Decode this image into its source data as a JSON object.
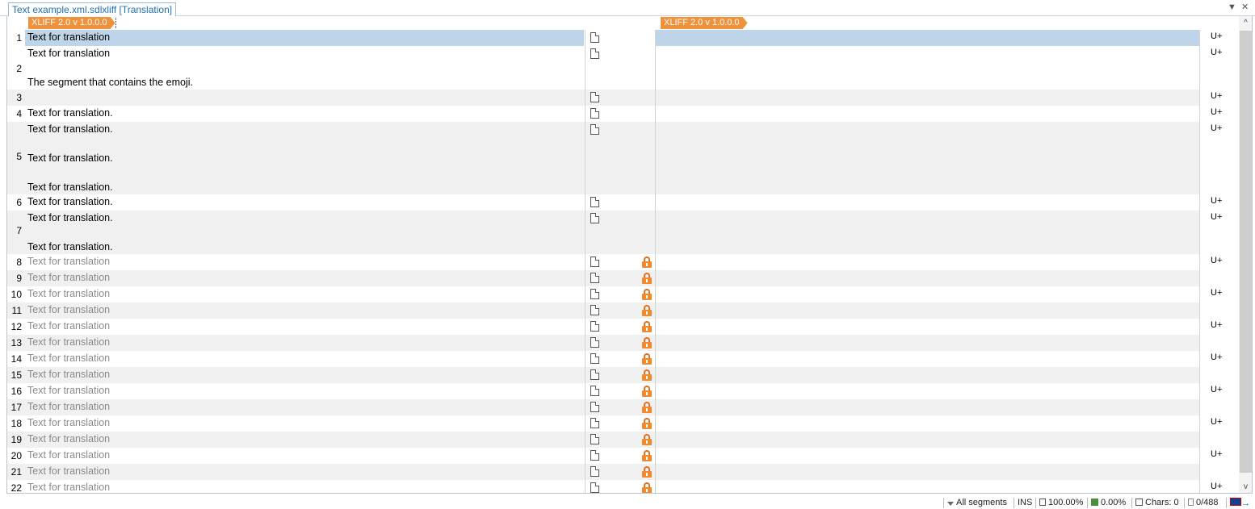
{
  "tab": {
    "title": "Text example.xml.sdlxliff [Translation]"
  },
  "window_controls": {
    "menu_glyph": "▼",
    "close_glyph": "✕"
  },
  "header": {
    "source_tag": "XLIFF 2.0 v 1.0.0.0",
    "target_tag": "XLIFF 2.0 v 1.0.0.0"
  },
  "colors": {
    "tag_orange": "#f0913c",
    "selected_row": "#bed4e8",
    "alt_row": "#f0f0f0",
    "locked_text": "#8a8a8a",
    "lock_icon": "#f08a2c"
  },
  "segments": [
    {
      "num": "1",
      "lines": [
        "Text for translation"
      ],
      "status": "U+",
      "locked": false
    },
    {
      "num": "",
      "lines": [
        "Text for translation"
      ],
      "status": "U+",
      "locked": false
    },
    {
      "num": "2",
      "lines": [
        ""
      ],
      "status": "",
      "locked": false
    },
    {
      "num": "",
      "lines": [
        "The segment that contains the emoji."
      ],
      "status": "",
      "locked": false
    },
    {
      "num": "3",
      "lines": [
        ""
      ],
      "status": "U+",
      "locked": false
    },
    {
      "num": "4",
      "lines": [
        "Text for translation."
      ],
      "status": "U+",
      "locked": false
    },
    {
      "num": "5",
      "lines": [
        "Text for translation.",
        "",
        "Text for translation.",
        "",
        "Text for translation."
      ],
      "status": "U+",
      "locked": false
    },
    {
      "num": "6",
      "lines": [
        "Text for translation."
      ],
      "status": "U+",
      "locked": false
    },
    {
      "num": "7",
      "lines": [
        "Text for translation.",
        "",
        "Text for translation."
      ],
      "status": "U+",
      "locked": false
    },
    {
      "num": "8",
      "lines": [
        "Text for translation"
      ],
      "status": "U+",
      "locked": true
    },
    {
      "num": "9",
      "lines": [
        "Text for translation"
      ],
      "status": "",
      "locked": true
    },
    {
      "num": "10",
      "lines": [
        "Text for translation"
      ],
      "status": "U+",
      "locked": true
    },
    {
      "num": "11",
      "lines": [
        "Text for translation"
      ],
      "status": "",
      "locked": true
    },
    {
      "num": "12",
      "lines": [
        "Text for translation"
      ],
      "status": "U+",
      "locked": true
    },
    {
      "num": "13",
      "lines": [
        "Text for translation"
      ],
      "status": "",
      "locked": true
    },
    {
      "num": "14",
      "lines": [
        "Text for translation"
      ],
      "status": "U+",
      "locked": true
    },
    {
      "num": "15",
      "lines": [
        "Text for translation"
      ],
      "status": "",
      "locked": true
    },
    {
      "num": "16",
      "lines": [
        "Text for translation"
      ],
      "status": "U+",
      "locked": true
    },
    {
      "num": "17",
      "lines": [
        "Text for translation"
      ],
      "status": "",
      "locked": true
    },
    {
      "num": "18",
      "lines": [
        "Text for translation"
      ],
      "status": "U+",
      "locked": true
    },
    {
      "num": "19",
      "lines": [
        "Text for translation"
      ],
      "status": "",
      "locked": true
    },
    {
      "num": "20",
      "lines": [
        "Text for translation"
      ],
      "status": "U+",
      "locked": true
    },
    {
      "num": "21",
      "lines": [
        "Text for translation"
      ],
      "status": "",
      "locked": true
    },
    {
      "num": "22",
      "lines": [
        "Text for translation"
      ],
      "status": "U+",
      "locked": true
    }
  ],
  "scrollbar": {
    "up_glyph": "^",
    "down_glyph": "v"
  },
  "statusbar": {
    "filter": "All segments",
    "mode": "INS",
    "percent_a": "100.00%",
    "percent_b": "0.00%",
    "chars": "Chars: 0",
    "count": "0/488"
  }
}
